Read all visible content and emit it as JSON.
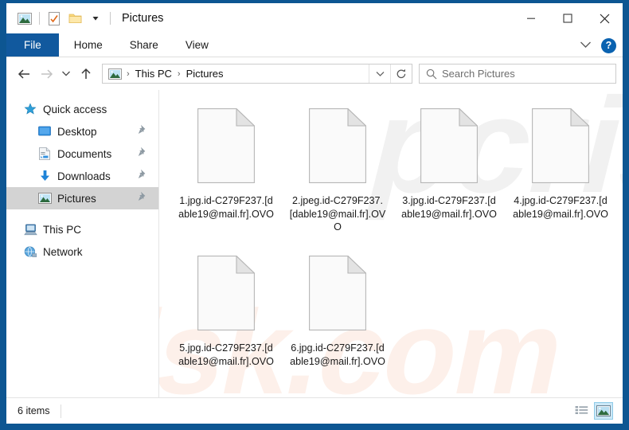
{
  "window": {
    "title": "Pictures",
    "quick_access_icons": [
      "picture-icon",
      "properties-checkbox-icon",
      "new-folder-icon",
      "customize-chevron-icon"
    ],
    "controls": {
      "minimize": "minimize-icon",
      "maximize": "maximize-icon",
      "close": "close-icon"
    }
  },
  "ribbon": {
    "tabs": [
      {
        "label": "File",
        "active": true
      },
      {
        "label": "Home",
        "active": false
      },
      {
        "label": "Share",
        "active": false
      },
      {
        "label": "View",
        "active": false
      }
    ],
    "collapse_icon": "chevron-down-icon",
    "help_label": "?"
  },
  "navigation": {
    "back": "back-arrow-icon",
    "forward": "forward-arrow-icon",
    "recent": "chevron-down-icon",
    "up": "up-arrow-icon",
    "breadcrumb": [
      "This PC",
      "Pictures"
    ],
    "breadcrumb_separator": "›",
    "dropdown_icon": "chevron-down-icon",
    "refresh_icon": "refresh-icon"
  },
  "search": {
    "icon": "search-icon",
    "placeholder": "Search Pictures",
    "value": ""
  },
  "sidebar": {
    "items": [
      {
        "label": "Quick access",
        "icon": "star-icon",
        "indent": false,
        "pinned": false,
        "selected": false
      },
      {
        "label": "Desktop",
        "icon": "desktop-icon",
        "indent": true,
        "pinned": true,
        "selected": false
      },
      {
        "label": "Documents",
        "icon": "documents-icon",
        "indent": true,
        "pinned": true,
        "selected": false
      },
      {
        "label": "Downloads",
        "icon": "downloads-icon",
        "indent": true,
        "pinned": true,
        "selected": false
      },
      {
        "label": "Pictures",
        "icon": "pictures-icon",
        "indent": true,
        "pinned": true,
        "selected": true
      },
      {
        "label": "This PC",
        "icon": "this-pc-icon",
        "indent": false,
        "pinned": false,
        "selected": false
      },
      {
        "label": "Network",
        "icon": "network-icon",
        "indent": false,
        "pinned": false,
        "selected": false
      }
    ]
  },
  "files": [
    {
      "name": "1.jpg.id-C279F237.[dable19@mail.fr].OVO",
      "icon": "generic-file-icon"
    },
    {
      "name": "2.jpeg.id-C279F237.[dable19@mail.fr].OVO",
      "icon": "generic-file-icon"
    },
    {
      "name": "3.jpg.id-C279F237.[dable19@mail.fr].OVO",
      "icon": "generic-file-icon"
    },
    {
      "name": "4.jpg.id-C279F237.[dable19@mail.fr].OVO",
      "icon": "generic-file-icon"
    },
    {
      "name": "5.jpg.id-C279F237.[dable19@mail.fr].OVO",
      "icon": "generic-file-icon"
    },
    {
      "name": "6.jpg.id-C279F237.[dable19@mail.fr].OVO",
      "icon": "generic-file-icon"
    }
  ],
  "watermarks": {
    "grey_text": "pcrisk",
    "pink_text": "risk.com"
  },
  "status": {
    "item_count": "6 items",
    "views": [
      {
        "name": "details-view",
        "selected": false
      },
      {
        "name": "large-icons-view",
        "selected": true
      }
    ]
  },
  "colors": {
    "frame": "#0d5692",
    "file_tab": "#11599e",
    "selection": "#d3d3d3",
    "view_active": "#cce8f7",
    "help": "#0a62b0"
  }
}
